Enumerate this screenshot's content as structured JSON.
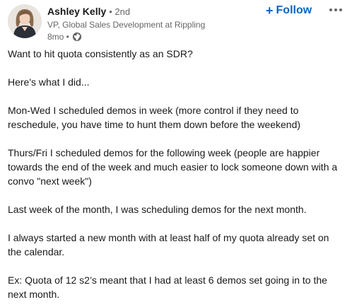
{
  "author": {
    "name": "Ashley Kelly",
    "degree": "• 2nd",
    "headline": "VP, Global Sales Development at Rippling",
    "time": "8mo •",
    "visibility_icon": "globe-icon"
  },
  "actions": {
    "follow_label": "Follow",
    "follow_icon": "+",
    "more_icon": "more-options-icon"
  },
  "post": {
    "paragraphs": [
      "Want to hit quota consistently as an SDR?",
      "Here's what I did...",
      "Mon-Wed I scheduled demos in week (more control if they need to reschedule, you have time to hunt them down before the weekend)",
      "Thurs/Fri I scheduled demos for the following week (people are happier towards the end of the week and much easier to lock someone down with a convo \"next week\")",
      "Last week of the month, I was scheduling demos for the next month.",
      "I always started a new month with at least half of my quota already set on the calendar.",
      "Ex: Quota of 12 s2’s meant that I had at least 6 demos set going in to the next month."
    ]
  },
  "colors": {
    "link_blue": "#0a66c2",
    "text_primary": "#191919",
    "text_secondary": "#666666"
  }
}
